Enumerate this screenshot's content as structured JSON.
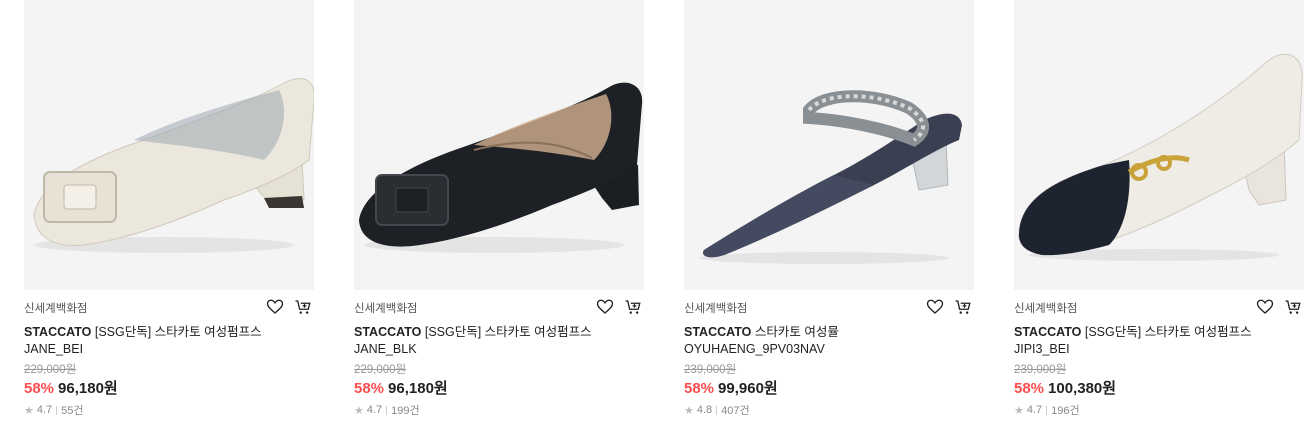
{
  "products": [
    {
      "store": "신세계백화점",
      "brand": "STACCATO",
      "name": "[SSG단독] 스타카토 여성펌프스 JANE_BEI",
      "original_price": "229,000원",
      "discount": "58%",
      "price": "96,180원",
      "rating": "4.7",
      "reviews": "55건",
      "image_icon": "shoe-pump-beige",
      "shoe_color": "#ece7dc"
    },
    {
      "store": "신세계백화점",
      "brand": "STACCATO",
      "name": "[SSG단독] 스타카토 여성펌프스 JANE_BLK",
      "original_price": "229,000원",
      "discount": "58%",
      "price": "96,180원",
      "rating": "4.7",
      "reviews": "199건",
      "image_icon": "shoe-pump-black",
      "shoe_color": "#1d2024"
    },
    {
      "store": "신세계백화점",
      "brand": "STACCATO",
      "name": "스타카토 여성뮬 OYUHAENG_9PV03NAV",
      "original_price": "239,000원",
      "discount": "58%",
      "price": "99,960원",
      "rating": "4.8",
      "reviews": "407건",
      "image_icon": "shoe-mule-navy",
      "shoe_color": "#3a3f52"
    },
    {
      "store": "신세계백화점",
      "brand": "STACCATO",
      "name": "[SSG단독] 스타카토 여성펌프스 JIPI3_BEI",
      "original_price": "239,000원",
      "discount": "58%",
      "price": "100,380원",
      "rating": "4.7",
      "reviews": "196건",
      "image_icon": "shoe-pump-ivory-black-toe",
      "shoe_color": "#efece6"
    }
  ],
  "colors": {
    "discount": "#ff4d4d",
    "accent_text": "#222222",
    "muted": "#999999"
  }
}
